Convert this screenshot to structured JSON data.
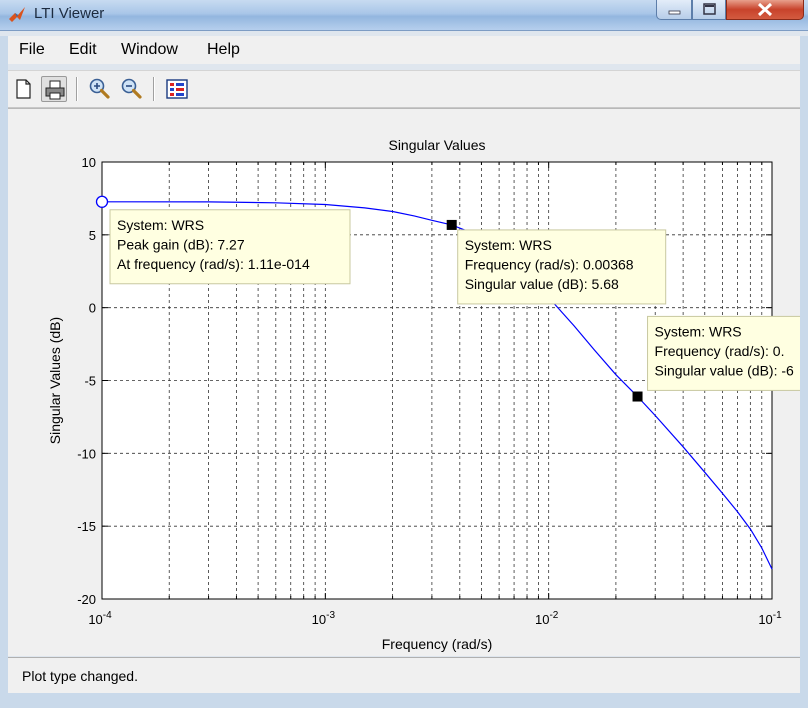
{
  "window": {
    "title": "LTI Viewer"
  },
  "menu": [
    "File",
    "Edit",
    "Window",
    "Help"
  ],
  "toolbar": {
    "icons": [
      "new-document-icon",
      "print-icon",
      "zoom-in-icon",
      "zoom-out-icon",
      "grid-view-icon"
    ]
  },
  "status": {
    "text": "Plot type changed."
  },
  "chart_data": {
    "type": "line",
    "title": "Singular Values",
    "xlabel": "Frequency (rad/s)",
    "ylabel": "Singular Values (dB)",
    "xscale": "log",
    "xlim": [
      0.0001,
      0.1
    ],
    "ylim": [
      -20,
      10
    ],
    "yticks": [
      10,
      5,
      0,
      -5,
      -10,
      -15,
      -20
    ],
    "xticks": [
      {
        "value": 0.0001,
        "base": "10",
        "exp": "-4"
      },
      {
        "value": 0.001,
        "base": "10",
        "exp": "-3"
      },
      {
        "value": 0.01,
        "base": "10",
        "exp": "-2"
      },
      {
        "value": 0.1,
        "base": "10",
        "exp": "-1"
      }
    ],
    "grid": true,
    "line_color": "#0000ff",
    "series": [
      {
        "x": [
          0.0001,
          0.0003,
          0.0006,
          0.001,
          0.0015,
          0.002,
          0.0025,
          0.003,
          0.00368,
          0.0045,
          0.0055,
          0.0065,
          0.008,
          0.01,
          0.013,
          0.016,
          0.02,
          0.025,
          0.03,
          0.04,
          0.05,
          0.06,
          0.07,
          0.08,
          0.09,
          0.1
        ],
        "y": [
          7.27,
          7.26,
          7.2,
          7.08,
          6.85,
          6.6,
          6.3,
          6.0,
          5.68,
          5.15,
          4.4,
          3.6,
          2.25,
          0.7,
          -1.25,
          -2.9,
          -4.6,
          -6.1,
          -7.4,
          -9.55,
          -11.3,
          -12.75,
          -14.0,
          -15.2,
          -16.5,
          -17.95
        ]
      }
    ],
    "markers": [
      {
        "x": 0.0001,
        "y": 7.27,
        "style": "open-circle"
      },
      {
        "x": 0.00368,
        "y": 5.68,
        "style": "filled-square"
      },
      {
        "x": 0.025,
        "y": -6.1,
        "style": "filled-square"
      }
    ],
    "datatips": [
      {
        "lines": [
          "System: WRS",
          "Peak gain (dB): 7.27",
          "At frequency (rad/s): 1.11e-014"
        ]
      },
      {
        "lines": [
          "System: WRS",
          "Frequency (rad/s): 0.00368",
          "Singular value (dB): 5.68"
        ]
      },
      {
        "lines": [
          "System: WRS",
          "Frequency (rad/s): 0.",
          "Singular value (dB): -6"
        ]
      }
    ]
  }
}
